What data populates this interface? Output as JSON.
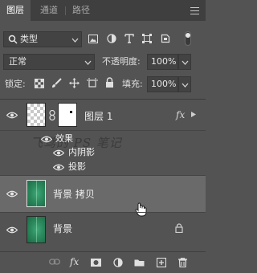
{
  "tabs": [
    {
      "label": "图层",
      "active": true
    },
    {
      "label": "通道",
      "active": false
    },
    {
      "label": "路径",
      "active": false
    }
  ],
  "filter": {
    "label": "类型"
  },
  "blend": {
    "mode": "正常",
    "opacity_label": "不透明度:",
    "opacity_value": "100%"
  },
  "lock": {
    "label": "锁定:",
    "fill_label": "填充:",
    "fill_value": "100%"
  },
  "layers": [
    {
      "name": "图层 1",
      "fx": "fx",
      "effects_label": "效果",
      "effects": [
        "内阴影",
        "投影"
      ]
    },
    {
      "name": "背景 拷贝",
      "selected": true
    },
    {
      "name": "背景",
      "locked": true
    }
  ],
  "watermark": "飞鸢的 PS 笔记",
  "colors": {
    "panel": "#535353",
    "tabbar": "#3f3f3f",
    "selected_row": "#6a6a6a",
    "field": "#434343",
    "leaf": "#2b8a5e"
  },
  "icons": [
    "search-icon",
    "image-filter-icon",
    "adjustment-filter-icon",
    "type-filter-icon",
    "shape-filter-icon",
    "smart-object-filter-icon",
    "toggle-filter-icon",
    "lock-transparent-icon",
    "lock-brush-icon",
    "lock-move-icon",
    "lock-artboard-icon",
    "lock-all-icon",
    "eye-icon",
    "chain-link-icon",
    "lock-icon",
    "link-layers-icon",
    "fx-icon",
    "mask-icon",
    "adjustment-icon",
    "folder-icon",
    "new-layer-icon",
    "trash-icon",
    "panel-menu-icon"
  ]
}
